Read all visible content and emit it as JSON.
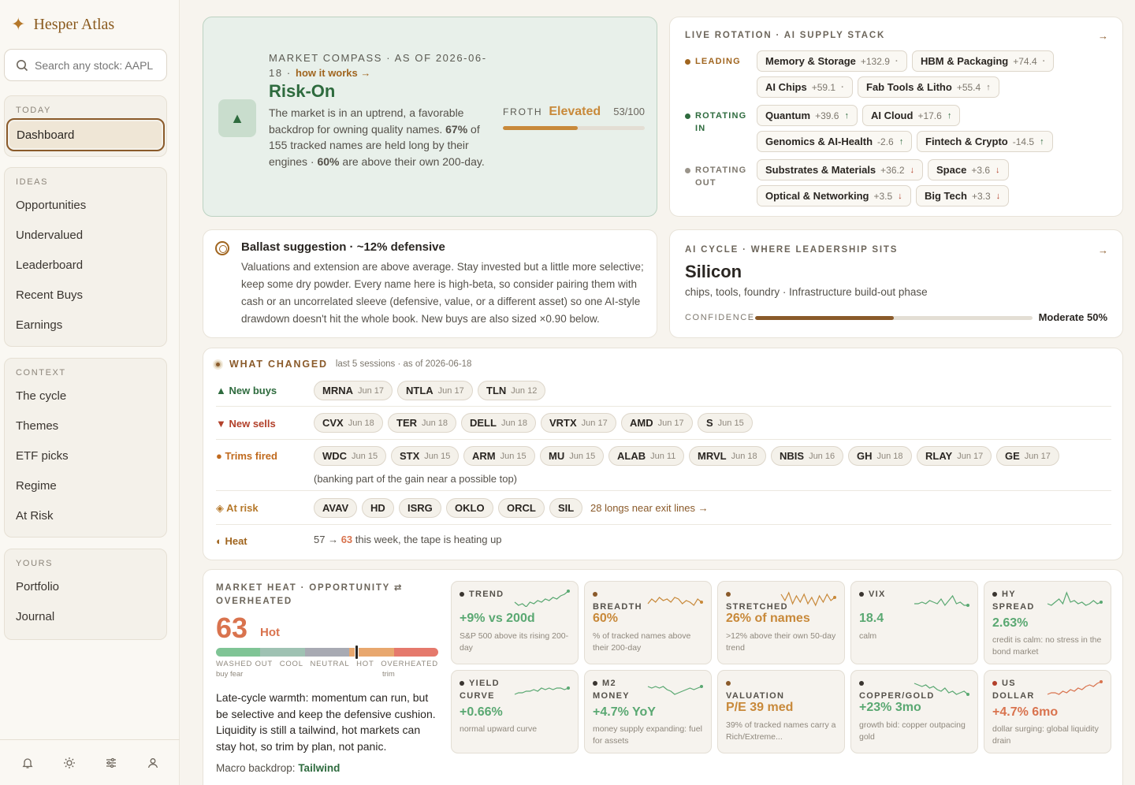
{
  "brand": {
    "name": "Hesper Atlas"
  },
  "search": {
    "placeholder": "Search any stock: AAPL"
  },
  "nav": {
    "today": {
      "heading": "TODAY",
      "items": [
        "Dashboard"
      ]
    },
    "ideas": {
      "heading": "IDEAS",
      "items": [
        "Opportunities",
        "Undervalued",
        "Leaderboard",
        "Recent Buys",
        "Earnings"
      ]
    },
    "context": {
      "heading": "CONTEXT",
      "items": [
        "The cycle",
        "Themes",
        "ETF picks",
        "Regime",
        "At Risk"
      ]
    },
    "yours": {
      "heading": "YOURS",
      "items": [
        "Portfolio",
        "Journal"
      ]
    }
  },
  "compass": {
    "label_line1": "MARKET COMPASS · AS OF 2026-06-",
    "label_line2": "18",
    "how": "how it works →",
    "title": "Risk-On",
    "desc_a": "The market is in an uptrend, a favorable backdrop for owning quality names.",
    "pct1": "67%",
    "desc_b": "of 155 tracked names are held long by their engines ·",
    "pct2": "60%",
    "desc_c": "are above their own 200-day.",
    "froth_label": "FROTH",
    "froth_value": "Elevated",
    "froth_score": "53/100",
    "froth_level": 53
  },
  "rotation": {
    "label": "LIVE ROTATION · AI SUPPLY STACK",
    "leading_label": "LEADING",
    "in_label_1": "ROTATING",
    "in_label_2": "IN",
    "out_label_1": "ROTATING",
    "out_label_2": "OUT",
    "leading": [
      {
        "name": "Memory & Storage",
        "val": "+132.9",
        "mark": "·"
      },
      {
        "name": "HBM & Packaging",
        "val": "+74.4",
        "mark": "·"
      },
      {
        "name": "AI Chips",
        "val": "+59.1",
        "mark": "·"
      },
      {
        "name": "Fab Tools & Litho",
        "val": "+55.4",
        "mark": "↑"
      }
    ],
    "rotating_in": [
      {
        "name": "Quantum",
        "val": "+39.6",
        "mark": "↑"
      },
      {
        "name": "AI Cloud",
        "val": "+17.6",
        "mark": "↑"
      },
      {
        "name": "Genomics & AI-Health",
        "val": "-2.6",
        "mark": "↑"
      },
      {
        "name": "Fintech & Crypto",
        "val": "-14.5",
        "mark": "↑"
      }
    ],
    "rotating_out": [
      {
        "name": "Substrates & Materials",
        "val": "+36.2",
        "mark": "↓"
      },
      {
        "name": "Space",
        "val": "+3.6",
        "mark": "↓"
      },
      {
        "name": "Optical & Networking",
        "val": "+3.5",
        "mark": "↓"
      },
      {
        "name": "Big Tech",
        "val": "+3.3",
        "mark": "↓"
      }
    ]
  },
  "ballast": {
    "title": "Ballast suggestion · ~12% defensive",
    "desc": "Valuations and extension are above average. Stay invested but a little more selective; keep some dry powder. Every name here is high-beta, so consider pairing them with cash or an uncorrelated sleeve (defensive, value, or a different asset) so one AI-style drawdown doesn't hit the whole book. New buys are also sized ×0.90 below."
  },
  "cycle": {
    "label": "AI CYCLE · WHERE LEADERSHIP SITS",
    "title": "Silicon",
    "desc": "chips, tools, foundry · Infrastructure build-out phase",
    "confidence_label": "CONFIDENCE",
    "confidence_value": "Moderate 50%",
    "confidence_level": 50
  },
  "changed": {
    "title": "WHAT CHANGED",
    "sub": "last 5 sessions · as of 2026-06-18",
    "new_buys_label": "▲ New buys",
    "new_buys": [
      {
        "t": "MRNA",
        "d": "Jun 17"
      },
      {
        "t": "NTLA",
        "d": "Jun 17"
      },
      {
        "t": "TLN",
        "d": "Jun 12"
      }
    ],
    "new_sells_label": "▼ New sells",
    "new_sells": [
      {
        "t": "CVX",
        "d": "Jun 18"
      },
      {
        "t": "TER",
        "d": "Jun 18"
      },
      {
        "t": "DELL",
        "d": "Jun 18"
      },
      {
        "t": "VRTX",
        "d": "Jun 17"
      },
      {
        "t": "AMD",
        "d": "Jun 17"
      },
      {
        "t": "S",
        "d": "Jun 15"
      }
    ],
    "trims_label": "● Trims fired",
    "trims": [
      {
        "t": "WDC",
        "d": "Jun 15"
      },
      {
        "t": "STX",
        "d": "Jun 15"
      },
      {
        "t": "ARM",
        "d": "Jun 15"
      },
      {
        "t": "MU",
        "d": "Jun 15"
      },
      {
        "t": "ALAB",
        "d": "Jun 11"
      },
      {
        "t": "MRVL",
        "d": "Jun 18"
      },
      {
        "t": "NBIS",
        "d": "Jun 16"
      },
      {
        "t": "GH",
        "d": "Jun 18"
      },
      {
        "t": "RLAY",
        "d": "Jun 17"
      },
      {
        "t": "GE",
        "d": "Jun 17"
      }
    ],
    "trims_note": "(banking part of the gain near a possible top)",
    "at_risk_label": "◈ At risk",
    "at_risk": [
      "AVAV",
      "HD",
      "ISRG",
      "OKLO",
      "ORCL",
      "SIL"
    ],
    "at_risk_link": "28 longs near exit lines →",
    "heat_label": "◐ Heat",
    "heat_from": "57 →",
    "heat_to": "63",
    "heat_note": "this week, the tape is heating up"
  },
  "heat": {
    "label_line1": "MARKET HEAT · OPPORTUNITY ⇄",
    "label_line2": "OVERHEATED",
    "score": "63",
    "state": "Hot",
    "score_level": 63,
    "gauge_labels": [
      "WASHED OUT",
      "COOL",
      "NEUTRAL",
      "HOT",
      "OVERHEATED"
    ],
    "gauge_sub_left": "buy fear",
    "gauge_sub_right": "trim",
    "text": "Late-cycle warmth: momentum can run, but be selective and keep the defensive cushion. Liquidity is still a tailwind, hot markets can stay hot, so trim by plan, not panic.",
    "macro_label": "Macro backdrop:",
    "macro_value": "Tailwind",
    "tiles": [
      {
        "label": "TREND",
        "value": "+9% vs 200d",
        "desc": "S&P 500 above its rising 200-day",
        "color": "#5aa872",
        "dot": "#3a3530"
      },
      {
        "label": "BREADTH",
        "value": "60%",
        "desc": "% of tracked names above their 200-day",
        "color": "#c8893a",
        "dot": "#8a5a2a"
      },
      {
        "label": "STRETCHED",
        "value": "26% of names",
        "desc": ">12% above their own 50-day trend",
        "color": "#c8893a",
        "dot": "#8a5a2a"
      },
      {
        "label": "VIX",
        "value": "18.4",
        "desc": "calm",
        "color": "#5aa872",
        "dot": "#3a3530"
      },
      {
        "label": "HY SPREAD",
        "value": "2.63%",
        "desc": "credit is calm: no stress in the bond market",
        "color": "#5aa872",
        "dot": "#3a3530"
      },
      {
        "label": "YIELD CURVE",
        "value": "+0.66%",
        "desc": "normal upward curve",
        "color": "#5aa872",
        "dot": "#3a3530"
      },
      {
        "label": "M2 MONEY",
        "value": "+4.7% YoY",
        "desc": "money supply expanding: fuel for assets",
        "color": "#5aa872",
        "dot": "#3a3530"
      },
      {
        "label": "VALUATION",
        "value": "P/E 39 med",
        "desc": "39% of tracked names carry a Rich/Extreme...",
        "color": "#c8893a",
        "dot": "#8a5a2a"
      },
      {
        "label": "COPPER/GOLD",
        "value": "+23% 3mo",
        "desc": "growth bid: copper outpacing gold",
        "color": "#5aa872",
        "dot": "#3a3530"
      },
      {
        "label": "US DOLLAR",
        "value": "+4.7% 6mo",
        "desc": "dollar surging: global liquidity drain",
        "color": "#d9734e",
        "dot": "#b2402a"
      }
    ]
  },
  "colors": {
    "accent": "#8a5a2a",
    "green": "#2e6b3e",
    "orange": "#c8893a",
    "red": "#d9734e"
  }
}
